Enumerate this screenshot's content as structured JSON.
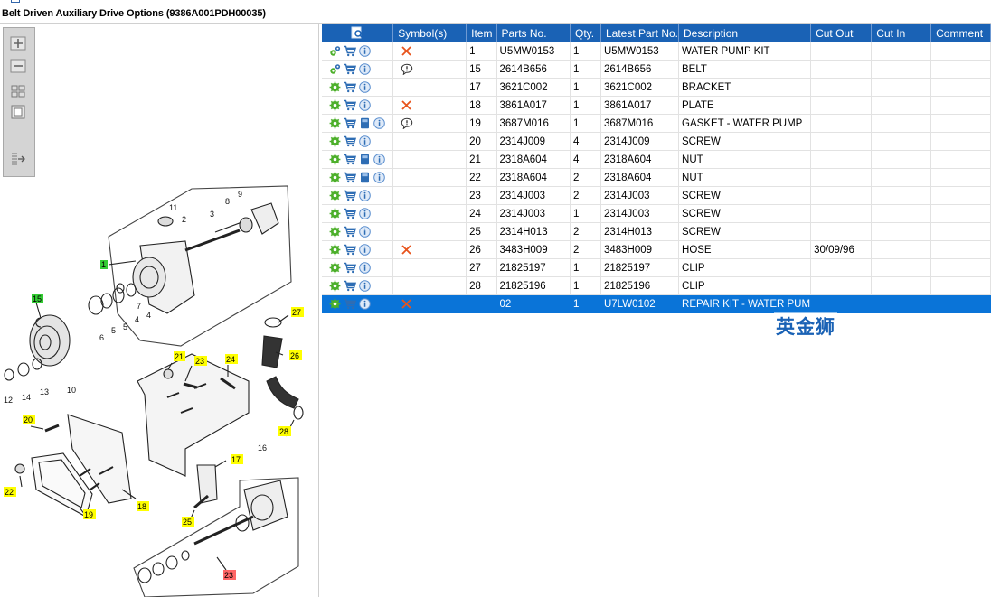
{
  "window": {
    "title": "Belt Driven Auxiliary Drive Options (9386A001PDH00035)"
  },
  "toolbar": {
    "items": [
      "zoom-in",
      "zoom-out",
      "fit-all",
      "fit-window",
      "export"
    ]
  },
  "callouts": [
    {
      "label": "1",
      "color": "#33cc33"
    },
    {
      "label": "15",
      "color": "#33cc33"
    },
    {
      "label": "27",
      "color": "#ffff00"
    },
    {
      "label": "21",
      "color": "#ffff00"
    },
    {
      "label": "23",
      "color": "#ffff00"
    },
    {
      "label": "24",
      "color": "#ffff00"
    },
    {
      "label": "26",
      "color": "#ffff00"
    },
    {
      "label": "20",
      "color": "#ffff00"
    },
    {
      "label": "28",
      "color": "#ffff00"
    },
    {
      "label": "17",
      "color": "#ffff00"
    },
    {
      "label": "22",
      "color": "#ffff00"
    },
    {
      "label": "18",
      "color": "#ffff00"
    },
    {
      "label": "19",
      "color": "#ffff00"
    },
    {
      "label": "25",
      "color": "#ffff00"
    },
    {
      "label": "23",
      "color": "#ff6666"
    }
  ],
  "plain_labels": [
    "9",
    "11",
    "2",
    "3",
    "8",
    "6",
    "5",
    "4",
    "7",
    "10",
    "12",
    "14",
    "13",
    "16"
  ],
  "table": {
    "headers": [
      "",
      "Symbol(s)",
      "Item",
      "Parts No.",
      "Qty.",
      "Latest Part No.",
      "Description",
      "Cut Out",
      "Cut In",
      "Comment"
    ],
    "rows": [
      {
        "icons": [
          "gears",
          "cart",
          "info"
        ],
        "symbols": [
          "x"
        ],
        "item": "1",
        "part": "U5MW0153",
        "qty": "1",
        "latest": "U5MW0153",
        "desc": "WATER PUMP KIT",
        "cut_out": "",
        "cut_in": "",
        "comment": ""
      },
      {
        "icons": [
          "gears",
          "cart",
          "info"
        ],
        "symbols": [
          "note"
        ],
        "item": "15",
        "part": "2614B656",
        "qty": "1",
        "latest": "2614B656",
        "desc": "BELT",
        "cut_out": "",
        "cut_in": "",
        "comment": ""
      },
      {
        "icons": [
          "gear",
          "cart",
          "info"
        ],
        "symbols": [],
        "item": "17",
        "part": "3621C002",
        "qty": "1",
        "latest": "3621C002",
        "desc": "BRACKET",
        "cut_out": "",
        "cut_in": "",
        "comment": ""
      },
      {
        "icons": [
          "gear",
          "cart",
          "info"
        ],
        "symbols": [
          "x"
        ],
        "item": "18",
        "part": "3861A017",
        "qty": "1",
        "latest": "3861A017",
        "desc": "PLATE",
        "cut_out": "",
        "cut_in": "",
        "comment": ""
      },
      {
        "icons": [
          "gear",
          "cart",
          "book",
          "info"
        ],
        "symbols": [
          "note"
        ],
        "item": "19",
        "part": "3687M016",
        "qty": "1",
        "latest": "3687M016",
        "desc": "GASKET - WATER PUMP",
        "cut_out": "",
        "cut_in": "",
        "comment": ""
      },
      {
        "icons": [
          "gear",
          "cart",
          "info"
        ],
        "symbols": [],
        "item": "20",
        "part": "2314J009",
        "qty": "4",
        "latest": "2314J009",
        "desc": "SCREW",
        "cut_out": "",
        "cut_in": "",
        "comment": ""
      },
      {
        "icons": [
          "gear",
          "cart",
          "book",
          "info"
        ],
        "symbols": [],
        "item": "21",
        "part": "2318A604",
        "qty": "4",
        "latest": "2318A604",
        "desc": "NUT",
        "cut_out": "",
        "cut_in": "",
        "comment": ""
      },
      {
        "icons": [
          "gear",
          "cart",
          "book",
          "info"
        ],
        "symbols": [],
        "item": "22",
        "part": "2318A604",
        "qty": "2",
        "latest": "2318A604",
        "desc": "NUT",
        "cut_out": "",
        "cut_in": "",
        "comment": ""
      },
      {
        "icons": [
          "gear",
          "cart",
          "info"
        ],
        "symbols": [],
        "item": "23",
        "part": "2314J003",
        "qty": "2",
        "latest": "2314J003",
        "desc": "SCREW",
        "cut_out": "",
        "cut_in": "",
        "comment": ""
      },
      {
        "icons": [
          "gear",
          "cart",
          "info"
        ],
        "symbols": [],
        "item": "24",
        "part": "2314J003",
        "qty": "1",
        "latest": "2314J003",
        "desc": "SCREW",
        "cut_out": "",
        "cut_in": "",
        "comment": ""
      },
      {
        "icons": [
          "gear",
          "cart",
          "info"
        ],
        "symbols": [],
        "item": "25",
        "part": "2314H013",
        "qty": "2",
        "latest": "2314H013",
        "desc": "SCREW",
        "cut_out": "",
        "cut_in": "",
        "comment": ""
      },
      {
        "icons": [
          "gear",
          "cart",
          "info"
        ],
        "symbols": [
          "x"
        ],
        "item": "26",
        "part": "3483H009",
        "qty": "2",
        "latest": "3483H009",
        "desc": "HOSE",
        "cut_out": "30/09/96",
        "cut_in": "",
        "comment": ""
      },
      {
        "icons": [
          "gear",
          "cart",
          "info"
        ],
        "symbols": [],
        "item": "27",
        "part": "21825197",
        "qty": "1",
        "latest": "21825197",
        "desc": "CLIP",
        "cut_out": "",
        "cut_in": "",
        "comment": ""
      },
      {
        "icons": [
          "gear",
          "cart",
          "info"
        ],
        "symbols": [],
        "item": "28",
        "part": "21825196",
        "qty": "1",
        "latest": "21825196",
        "desc": "CLIP",
        "cut_out": "",
        "cut_in": "",
        "comment": ""
      },
      {
        "icons": [
          "gear",
          "cart",
          "info"
        ],
        "symbols": [
          "x"
        ],
        "item": "",
        "part": "02",
        "qty": "1",
        "latest": "U7LW0102",
        "desc": "REPAIR KIT - WATER PUM",
        "cut_out": "",
        "cut_in": "",
        "comment": "",
        "selected": true
      }
    ]
  },
  "watermark": "英金狮",
  "colors": {
    "header": "#1a62b5",
    "selected": "#0a74d8",
    "x_symbol": "#e8541c",
    "gear": "#4caf2a",
    "cart": "#2e6db4"
  }
}
